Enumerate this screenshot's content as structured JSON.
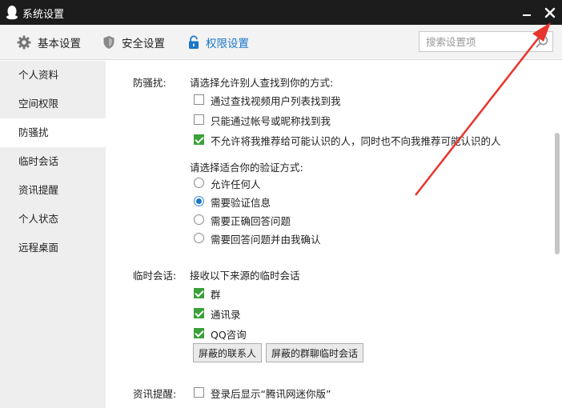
{
  "window": {
    "title": "系统设置"
  },
  "tabs": [
    {
      "label": "基本设置",
      "icon": "gear-icon"
    },
    {
      "label": "安全设置",
      "icon": "shield-icon"
    },
    {
      "label": "权限设置",
      "icon": "lock-icon",
      "active": true
    }
  ],
  "search": {
    "placeholder": "搜索设置项",
    "value": ""
  },
  "sidebar": {
    "items": [
      {
        "label": "个人资料"
      },
      {
        "label": "空间权限"
      },
      {
        "label": "防骚扰",
        "active": true
      },
      {
        "label": "临时会话"
      },
      {
        "label": "资讯提醒"
      },
      {
        "label": "个人状态"
      },
      {
        "label": "远程桌面"
      }
    ]
  },
  "anti_harass": {
    "section_label": "防骚扰:",
    "find_prompt": "请选择允许别人查找到你的方式:",
    "find_options": [
      {
        "label": "通过查找视频用户列表找到我",
        "checked": false
      },
      {
        "label": "只能通过帐号或昵称找到我",
        "checked": false
      },
      {
        "label": "不允许将我推荐给可能认识的人，同时也不向我推荐可能认识的人",
        "checked": true
      }
    ],
    "verify_prompt": "请选择适合你的验证方式:",
    "verify_options": [
      {
        "label": "允许任何人",
        "selected": false
      },
      {
        "label": "需要验证信息",
        "selected": true
      },
      {
        "label": "需要正确回答问题",
        "selected": false
      },
      {
        "label": "需要回答问题并由我确认",
        "selected": false
      }
    ]
  },
  "temp_session": {
    "section_label": "临时会话:",
    "prompt": "接收以下来源的临时会话",
    "options": [
      {
        "label": "群",
        "checked": true
      },
      {
        "label": "通讯录",
        "checked": true
      },
      {
        "label": "QQ咨询",
        "checked": true
      }
    ],
    "buttons": {
      "blocked_contacts": "屏蔽的联系人",
      "blocked_group_sessions": "屏蔽的群聊临时会话"
    }
  },
  "news_reminder": {
    "section_label": "资讯提醒:",
    "option": {
      "label": "登录后显示“腾讯网迷你版”",
      "checked": false
    }
  },
  "colors": {
    "accent": "#1a76c8",
    "check_green": "#3aa13a",
    "titlebar": "#1c1c1c",
    "annotation_red": "#e8352b"
  }
}
